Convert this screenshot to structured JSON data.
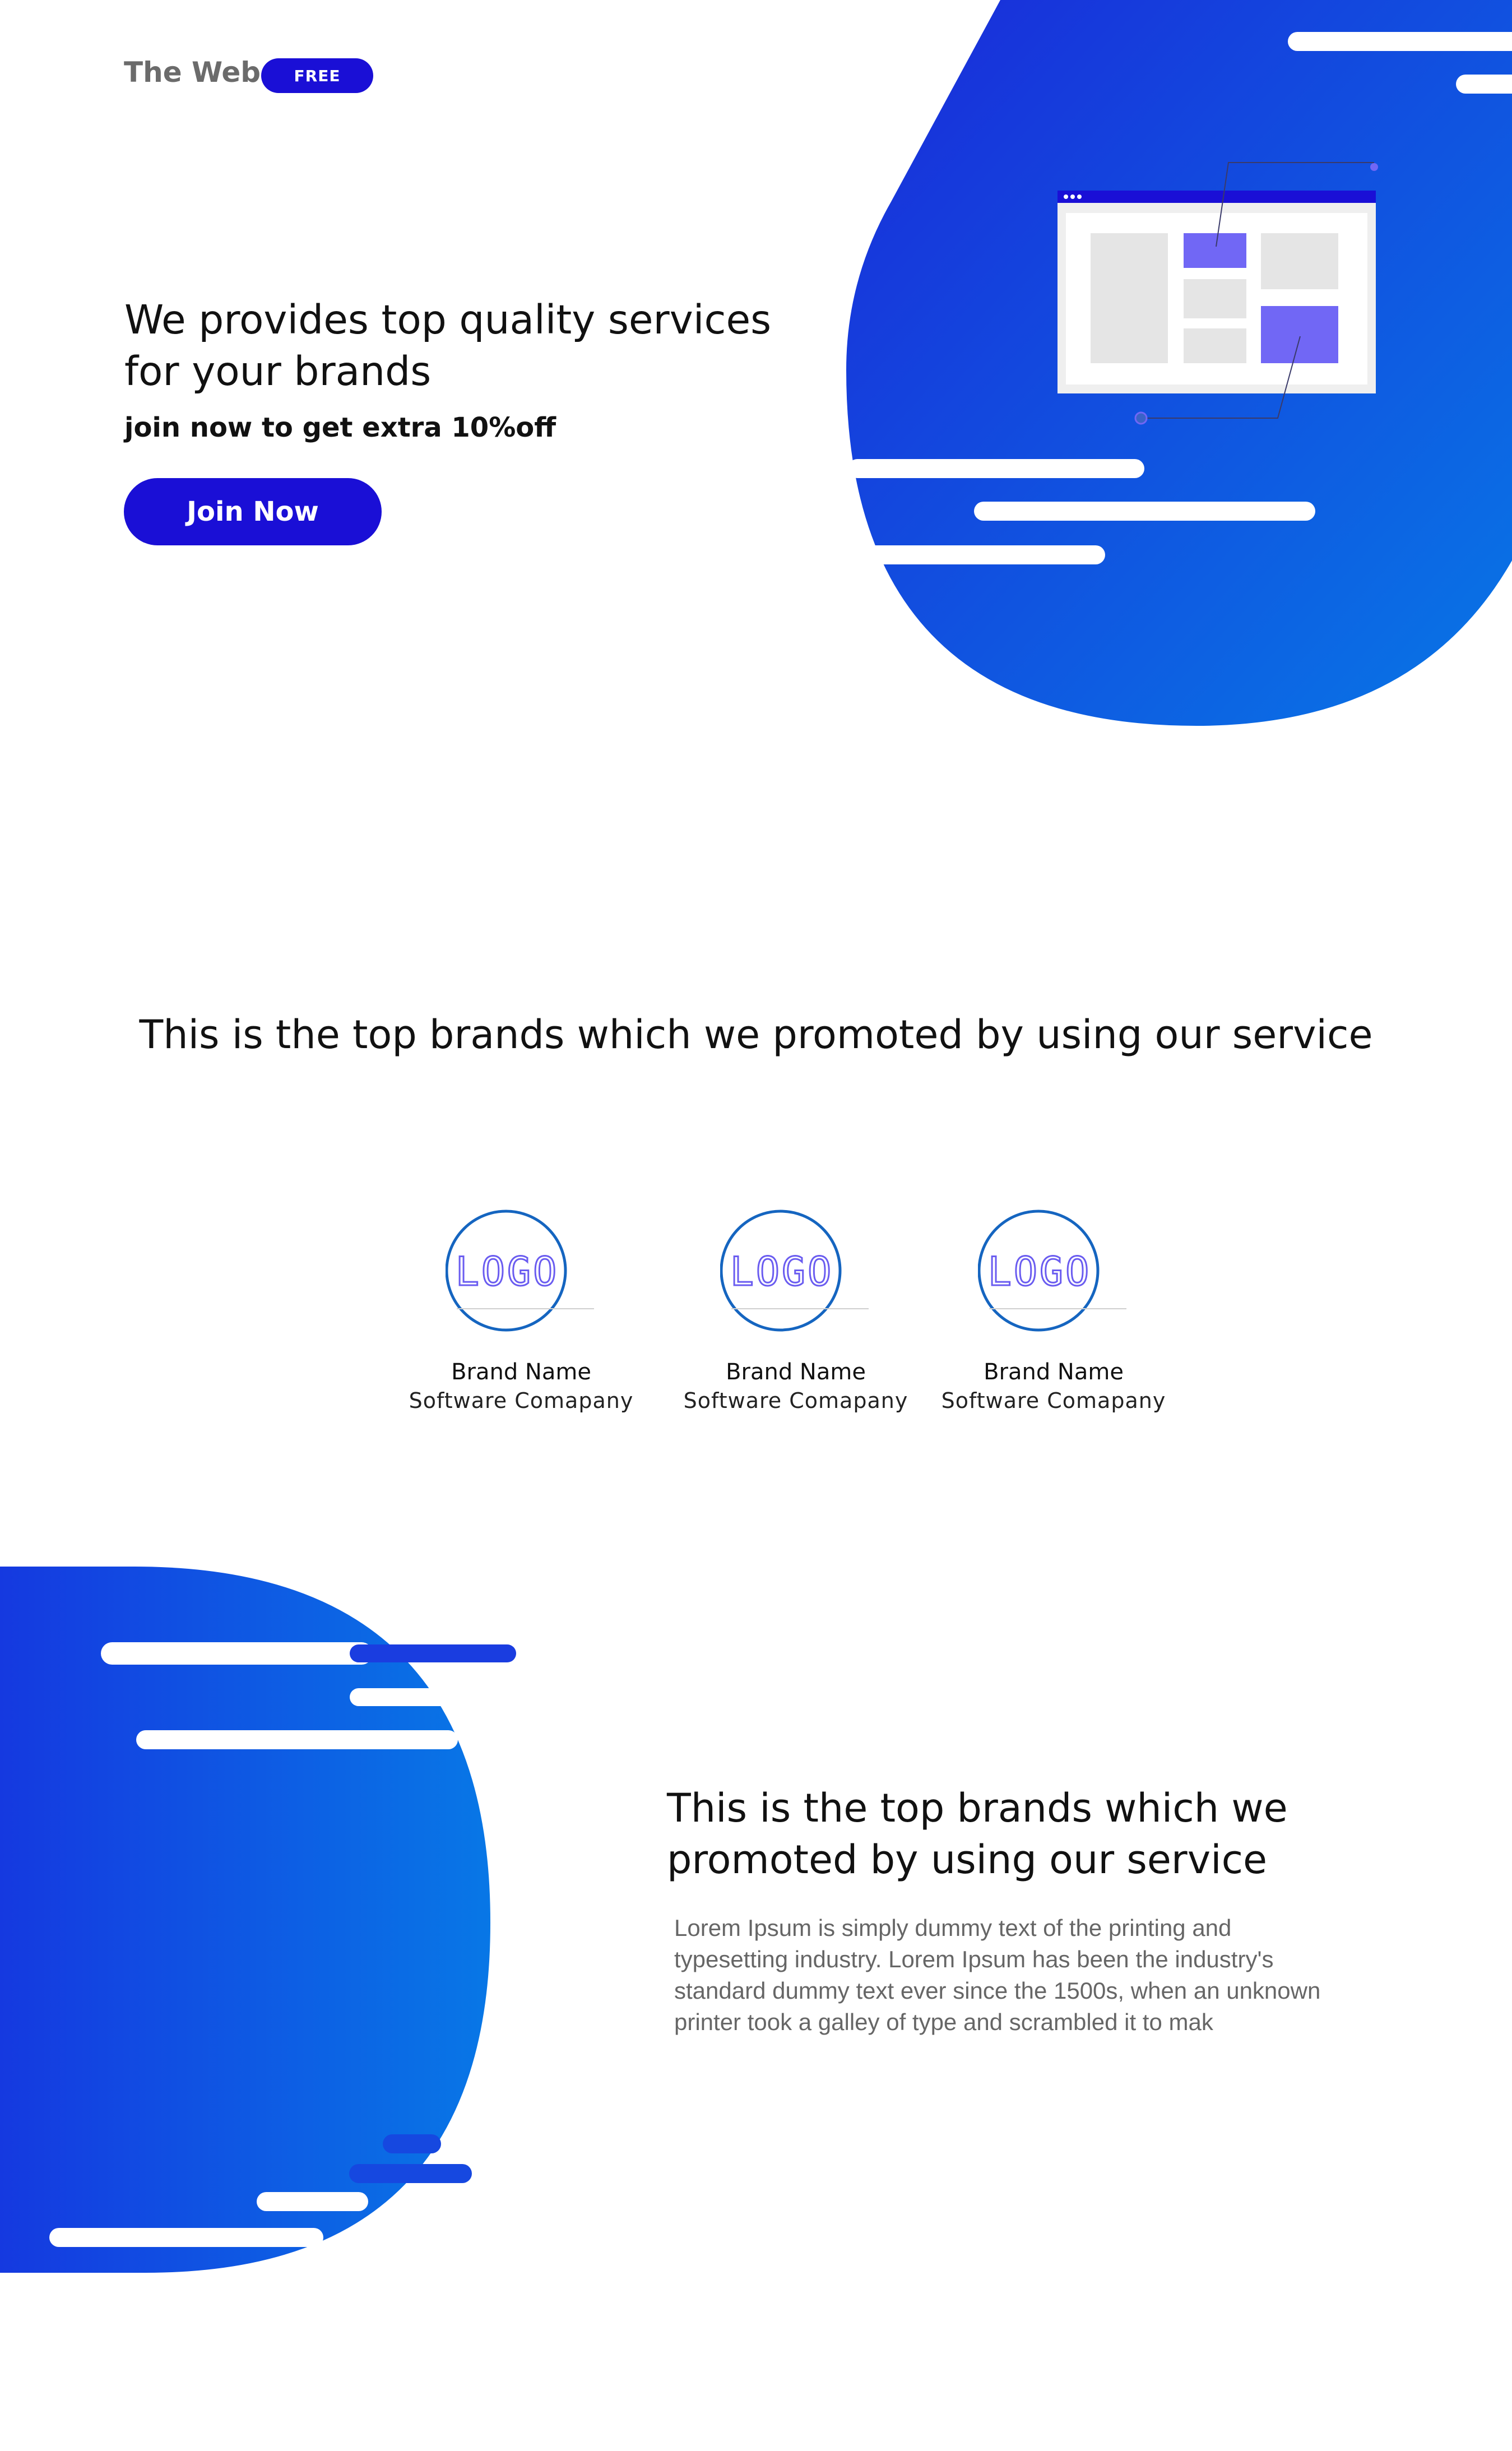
{
  "header": {
    "brand": "The Web",
    "badge": "FREE"
  },
  "hero": {
    "heading": "We provides top quality services for your brands",
    "subheading": "join now to get extra 10%off",
    "cta_label": "Join Now"
  },
  "brands_section": {
    "heading": "This is the top brands which we promoted by using our service",
    "brands": [
      {
        "logo_text": "LOGO",
        "name": "Brand Name",
        "company": "Software Comapany"
      },
      {
        "logo_text": "LOGO",
        "name": "Brand Name",
        "company": "Software Comapany"
      },
      {
        "logo_text": "LOGO",
        "name": "Brand Name",
        "company": "Software Comapany"
      }
    ]
  },
  "info_section": {
    "heading": "This is the top brands which we promoted by using our service",
    "body": "Lorem Ipsum is simply dummy text of the printing and typesetting industry. Lorem Ipsum has been the industry's standard dummy text ever since the 1500s, when an unknown printer took a galley of type and scrambled it to mak"
  },
  "colors": {
    "primary": "#1a0fd6",
    "gradient_start": "#1a2fe0",
    "gradient_end": "#0877e6",
    "accent_purple": "#7167f5",
    "logo_ring": "#1565c0"
  },
  "icons": {
    "hero_illustration": "browser-window-illustration",
    "brand_logo": "logo-circle-icon"
  }
}
